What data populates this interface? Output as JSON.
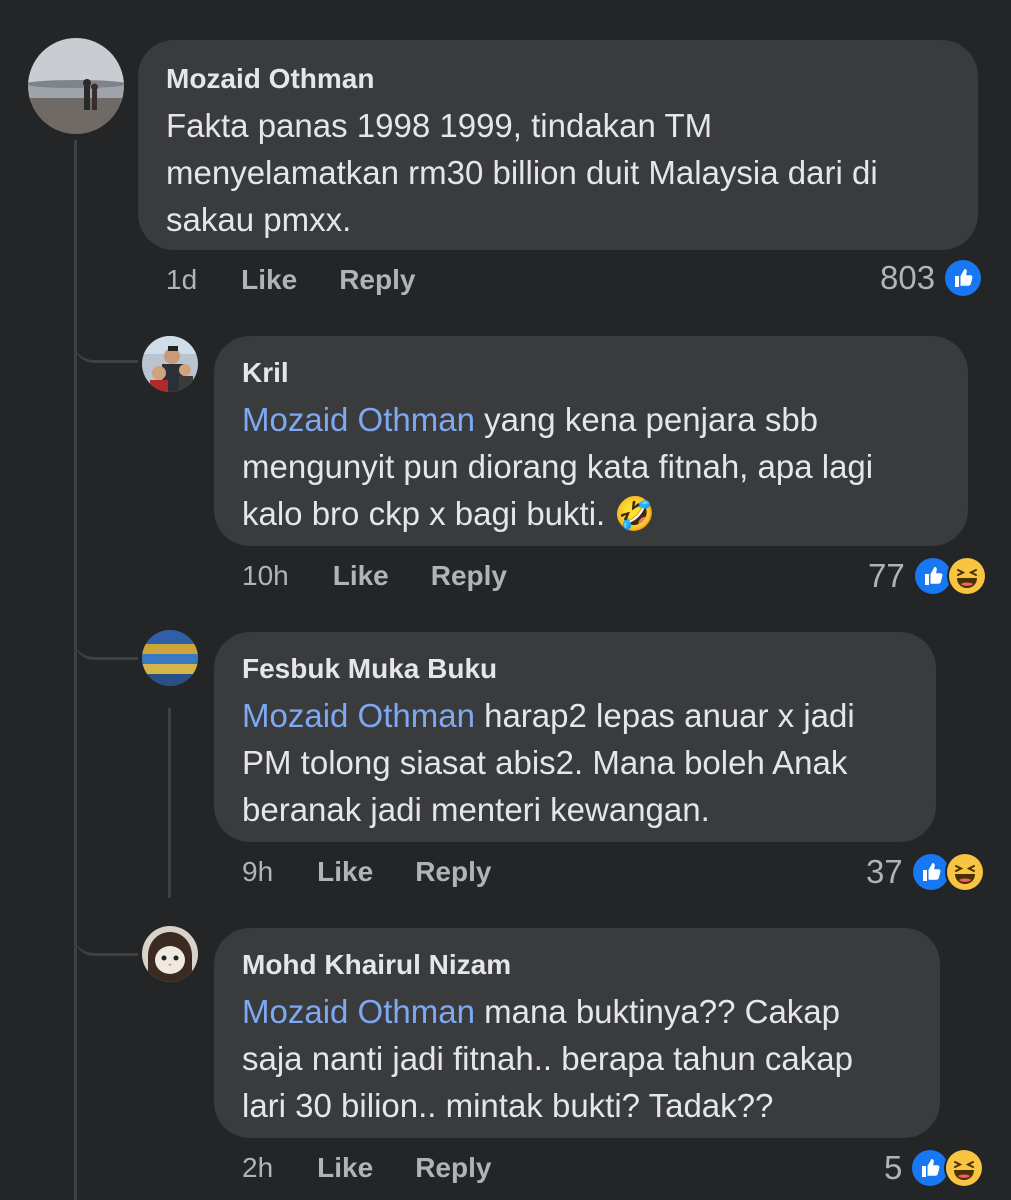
{
  "comments": [
    {
      "author": "Mozaid Othman",
      "lines": [
        "Fakta panas 1998 1999, tindakan TM",
        "menyelamatkan rm30 billion duit Malaysia dari di",
        "sakau pmxx."
      ],
      "time": "1d",
      "like_label": "Like",
      "reply_label": "Reply",
      "reaction_count": "803",
      "reactions": [
        "like-icon"
      ]
    },
    {
      "author": "Kril",
      "mention": "Mozaid Othman",
      "lines": [
        " yang kena penjara sbb",
        "mengunyit pun diorang kata fitnah, apa lagi",
        "kalo bro ckp x bagi bukti. 🤣"
      ],
      "time": "10h",
      "like_label": "Like",
      "reply_label": "Reply",
      "reaction_count": "77",
      "reactions": [
        "like-icon",
        "haha-icon"
      ]
    },
    {
      "author": "Fesbuk Muka Buku",
      "mention": "Mozaid Othman",
      "lines": [
        " harap2 lepas anuar x jadi",
        "PM tolong siasat abis2. Mana boleh Anak",
        "beranak jadi menteri kewangan."
      ],
      "time": "9h",
      "like_label": "Like",
      "reply_label": "Reply",
      "reaction_count": "37",
      "reactions": [
        "like-icon",
        "haha-icon"
      ]
    },
    {
      "author": "Mohd Khairul Nizam",
      "mention": "Mozaid Othman",
      "lines": [
        " mana buktinya?? Cakap",
        "saja nanti jadi fitnah.. berapa tahun cakap",
        "lari 30 bilion.. mintak bukti? Tadak??"
      ],
      "time": "2h",
      "like_label": "Like",
      "reply_label": "Reply",
      "reaction_count": "5",
      "reactions": [
        "like-icon",
        "haha-icon"
      ]
    }
  ],
  "colors": {
    "background": "#242526",
    "bubble": "#3a3b3c",
    "mention": "#7ea8f2",
    "like_blue": "#1877f2",
    "haha_yellow": "#f7c542"
  }
}
